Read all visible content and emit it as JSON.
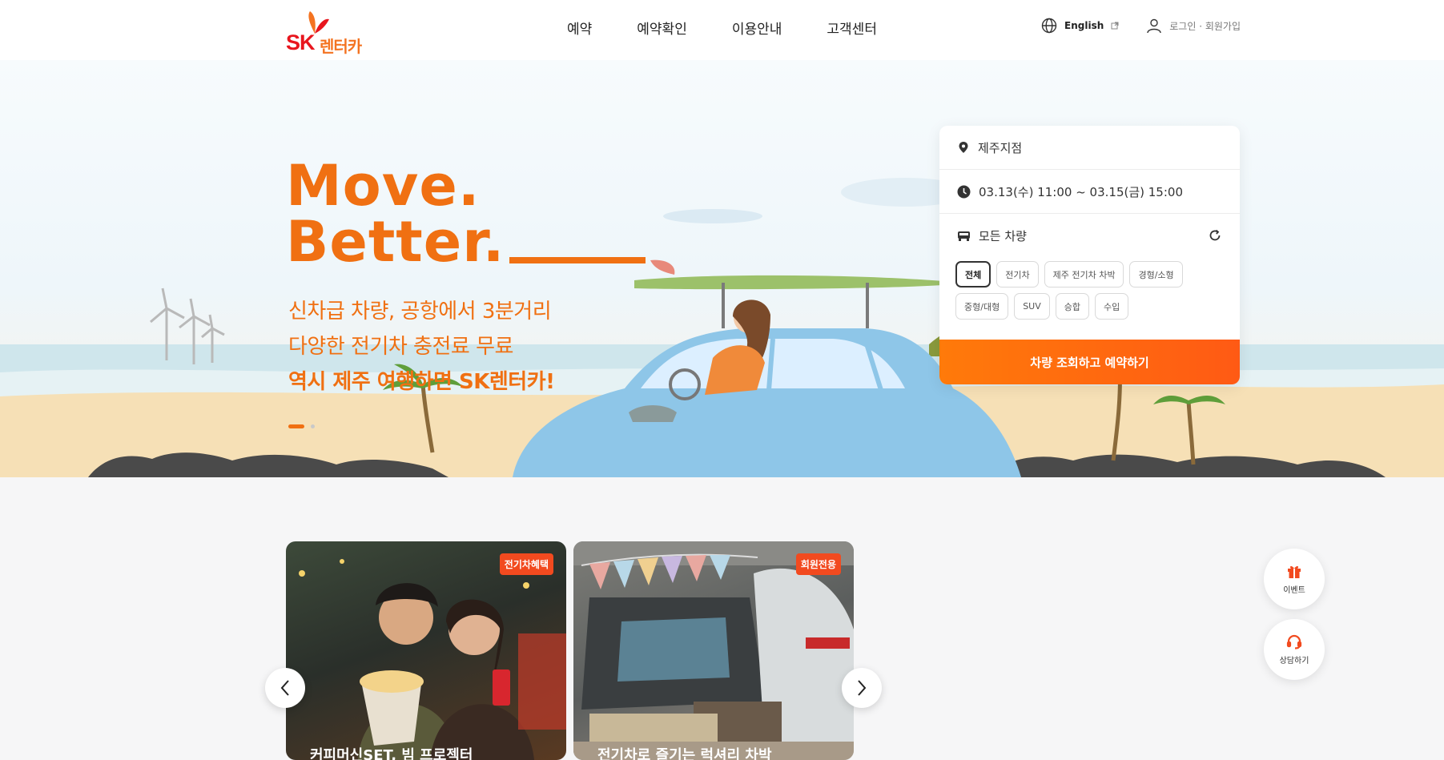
{
  "header": {
    "logo_sk": "SK",
    "logo_name": "렌터카",
    "nav": [
      "예약",
      "예약확인",
      "이용안내",
      "고객센터"
    ],
    "language": "English",
    "login": "로그인 · 회원가입"
  },
  "hero": {
    "headline_line1": "Move.",
    "headline_line2": "Better.",
    "sub_line1": "신차급 차량, 공항에서 3분거리",
    "sub_line2": "다양한 전기차 충전료 무료",
    "sub_line3": "역시 제주 여행하면 SK렌터카!"
  },
  "booking": {
    "location": "제주지점",
    "datetime": "03.13(수) 11:00 ~ 03.15(금) 15:00",
    "vehicle_type": "모든 차량",
    "chips": [
      "전체",
      "전기차",
      "제주 전기차 차박",
      "경형/소형",
      "중형/대형",
      "SUV",
      "승합",
      "수입"
    ],
    "active_chip": "전체",
    "cta": "차량 조회하고 예약하기"
  },
  "cards": [
    {
      "badge": "전기차혜택",
      "title": "커피머신SET, 빔 프로젝터"
    },
    {
      "badge": "회원전용",
      "title": "전기차로 즐기는 럭셔리 차박"
    }
  ],
  "floating": {
    "event": "이벤트",
    "consult": "상담하기"
  },
  "colors": {
    "brand_orange": "#f07012",
    "sk_red": "#e8161e",
    "badge_red": "#f24a1f"
  }
}
